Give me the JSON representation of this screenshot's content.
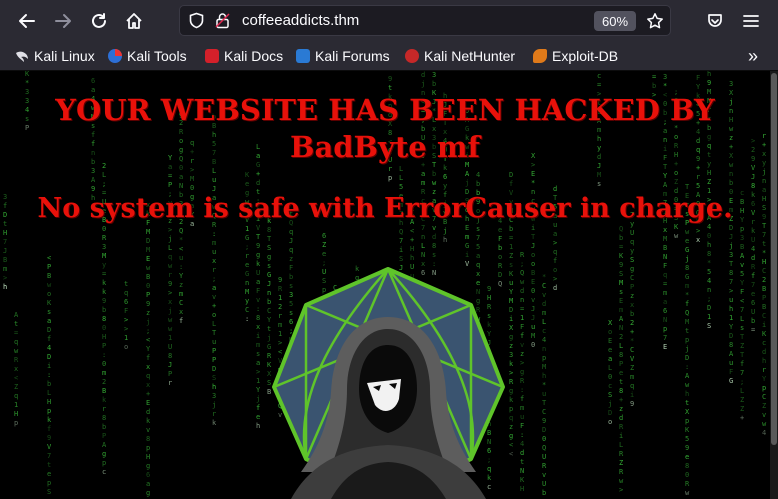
{
  "browser": {
    "url": "coffeeaddicts.thm",
    "zoom": "60%",
    "bookmarks": [
      {
        "label": "Kali Linux",
        "icon": "kali-dragon-icon"
      },
      {
        "label": "Kali Tools",
        "icon": "kali-tools-icon"
      },
      {
        "label": "Kali Docs",
        "icon": "kali-docs-icon"
      },
      {
        "label": "Kali Forums",
        "icon": "kali-forums-icon"
      },
      {
        "label": "Kali NetHunter",
        "icon": "nethunter-icon"
      },
      {
        "label": "Exploit-DB",
        "icon": "exploit-db-icon"
      }
    ],
    "overflow_glyph": "»"
  },
  "page": {
    "headline_line1": "YOUR WEBSITE HAS BEEN HACKED BY",
    "headline_line2": "BadByte mf",
    "subheadline": "No system is safe with ErrorCauser in charge.",
    "colors": {
      "headline": "#e8110a",
      "matrix": "#3cc43c",
      "logo_ring": "#5fc42a",
      "logo_fill": "#3a5470"
    }
  }
}
